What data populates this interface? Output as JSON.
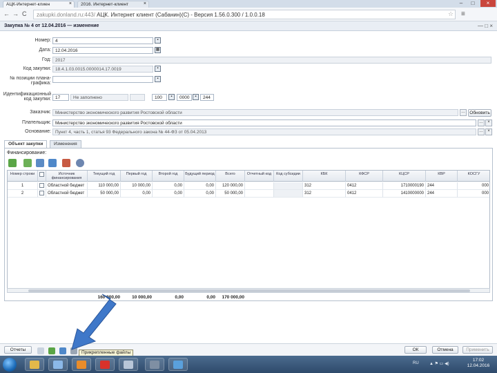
{
  "browser": {
    "tabs": [
      {
        "label": "АЦК-Интернет-клиен",
        "close": "×"
      },
      {
        "label": "2016. Интернет-клиент",
        "close": "×"
      }
    ],
    "window_controls": {
      "minimize": "–",
      "maximize": "□",
      "close": "×"
    },
    "url_prefix": "zakupki.donland.ru:443/",
    "url_rest": " АЦК. Интернет клиент (Сабанин)(С) - Версия 1.56.0.300 / 1.0.0.18",
    "back_glyph": "←",
    "forward_glyph": "→",
    "reload_glyph": "C",
    "home_glyph": "⌂",
    "star_glyph": "☆",
    "menu_glyph": "≡"
  },
  "form": {
    "title": "Закупка № 4 от 12.04.2016 — изменение",
    "title_controls": "— □ ×",
    "fields": {
      "number_label": "Номер:",
      "number_value": "4",
      "date_label": "Дата:",
      "date_value": "12.04.2016",
      "year_label": "Год:",
      "year_value": "2017",
      "code_label": "Код закупки:",
      "code_value": "18.4.1.03.0015.0000014.17.0019",
      "plan_pos_label": "№ позиции плана-графика:",
      "plan_pos_value": "",
      "ikz_label": "Идентификационный код закупки:",
      "ikz_part1": "17",
      "ikz_part2": "Не заполнено",
      "ikz_part3": "",
      "ikz_part4": "100",
      "ikz_part5": "0000",
      "ikz_part6": "244",
      "customer_label": "Заказчик:",
      "customer_value": "Министерство экономического развития Ростовской области",
      "customer_button": "Обновить",
      "payer_label": "Плательщик:",
      "payer_value": "Министерство экономического развития Ростовской области",
      "basis_label": "Основание:",
      "basis_value": "Пункт 4, часть 1, статья 93 Федерального закона № 44-ФЗ от 05.04.2013"
    },
    "tabs": [
      {
        "label": "Объект закупки"
      },
      {
        "label": "Изменения"
      }
    ],
    "section_title": "Финансирование:",
    "toolbar_icons": [
      "edit-icon",
      "add-icon",
      "copy-icon",
      "import-icon",
      "export-icon",
      "settings-icon"
    ],
    "grid": {
      "headers": [
        "Номер строки",
        "",
        "Источник финансирования",
        "Текущий год",
        "Первый год",
        "Второй год",
        "Будущий период",
        "Всего",
        "Отчетный код",
        "Код субсидии",
        "КБК",
        "КФСР",
        "КЦСР",
        "КВР",
        "КОСГУ"
      ],
      "rows": [
        {
          "num": "1",
          "source": "Областной бюджет",
          "cur": "110 000,00",
          "first": "10 000,00",
          "second": "0,00",
          "future": "0,00",
          "total": "120 000,00",
          "kbk": "312",
          "kfsr": "0412",
          "kcsr": "1710000190",
          "kvr": "244",
          "kosgu": "000"
        },
        {
          "num": "2",
          "source": "Областной бюджет",
          "cur": "50 000,00",
          "first": "0,00",
          "second": "0,00",
          "future": "0,00",
          "total": "50 000,00",
          "kbk": "312",
          "kfsr": "0412",
          "kcsr": "1410000000",
          "kvr": "244",
          "kosgu": "000"
        }
      ],
      "totals": {
        "cur": "160 000,00",
        "first": "10 000,00",
        "second": "0,00",
        "future": "0,00",
        "total": "170 000,00"
      }
    },
    "footer": {
      "actions_button": "Отчеты",
      "tooltip": "Прикрепленные файлы",
      "ok_button": "ОК",
      "cancel_button": "Отмена",
      "apply_button": "Применить"
    }
  },
  "taskbar": {
    "apps": [
      "explorer-icon",
      "media-icon",
      "outlook-icon",
      "yandex-icon",
      "network-icon",
      "tools-icon",
      "monitor-icon"
    ],
    "lang": "RU",
    "time": "17:02",
    "date": "12.04.2016"
  },
  "colors": {
    "arrow": "#3f78c9",
    "accent": "#1c6bb8"
  }
}
